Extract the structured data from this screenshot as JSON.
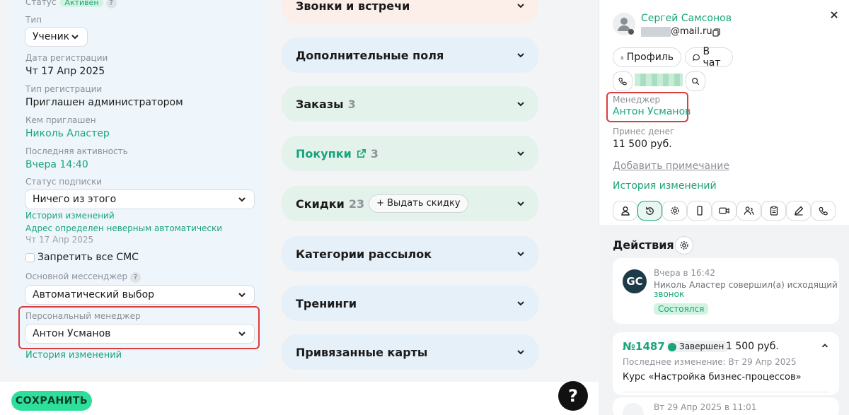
{
  "left": {
    "status_label": "Статус",
    "status_badge": "Активен",
    "type_label": "Тип",
    "type_value": "Ученик",
    "reg_date_label": "Дата регистрации",
    "reg_date_value": "Чт 17 Апр 2025",
    "reg_type_label": "Тип регистрации",
    "reg_type_value": "Приглашен администратором",
    "invited_by_label": "Кем приглашен",
    "invited_by_value": "Николь Аластер",
    "last_activity_label": "Последняя активность",
    "last_activity_value": "Вчера 14:40",
    "sub_status_label": "Статус подписки",
    "sub_status_value": "Ничего из этого",
    "history_link": "История изменений",
    "address_note": "Адрес определен неверным автоматически",
    "address_date": "Чт 17 Апр 2025",
    "sms_label": "Запретить все СМС",
    "messenger_label": "Основной мессенджер",
    "messenger_value": "Автоматический выбор",
    "manager_label": "Персональный менеджер",
    "manager_value": "Антон Усманов",
    "history_link2": "История изменений"
  },
  "accordions": [
    {
      "title": "Звонки и встречи",
      "count": ""
    },
    {
      "title": "Дополнительные поля",
      "count": ""
    },
    {
      "title": "Заказы",
      "count": "3"
    },
    {
      "title": "Покупки",
      "count": "3"
    },
    {
      "title": "Скидки",
      "count": "23",
      "action": "+ Выдать скидку"
    },
    {
      "title": "Категории рассылок",
      "count": ""
    },
    {
      "title": "Тренинги",
      "count": ""
    },
    {
      "title": "Привязанные карты",
      "count": ""
    }
  ],
  "footer": {
    "save": "СОХРАНИТЬ",
    "help": "?"
  },
  "profile": {
    "name": "Сергей Самсонов",
    "email": "@mail.ru",
    "profile_btn": "Профиль",
    "chat_btn": "В чат",
    "manager_label": "Менеджер",
    "manager_name": "Антон Усманов",
    "money_label": "Принес денег",
    "money_value": "11 500 руб.",
    "add_note": "Добавить примечание",
    "history": "История изменений"
  },
  "actions": {
    "title": "Действия",
    "item1": {
      "avatar": "GC",
      "time": "Вчера в 16:42",
      "text": "Николь Аластер совершил(а) исходящий",
      "link": "звонок",
      "status": "Состоялся"
    },
    "order": {
      "number": "№1487",
      "status": "Завершен",
      "sum": "1 500 руб.",
      "changed": "Последнее изменение: Вт 29 Апр 2025",
      "course": "Курс «Настройка бизнес-процессов»"
    },
    "item3_time": "Вт 29 Апр 2025 в 11:01"
  },
  "colors": {
    "accent": "#1aa37a",
    "save": "#2edf9b",
    "highlight": "#dc3c3c"
  }
}
